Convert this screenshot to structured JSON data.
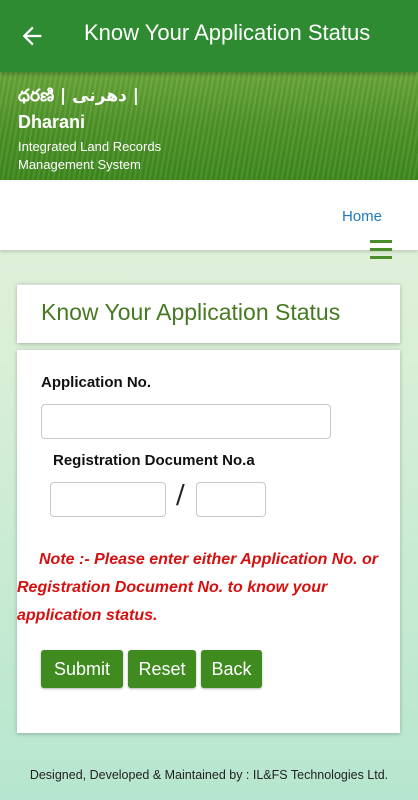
{
  "appbar": {
    "title": "Know Your Application Status",
    "back_icon": "arrow-left-icon",
    "bg_color": "#2e8b32"
  },
  "banner": {
    "scripts": "ధరణి | دھرنی |",
    "title": "Dharani",
    "subtitle": "Integrated Land Records Management System"
  },
  "nav": {
    "home_label": "Home",
    "menu_icon": "hamburger-menu-icon"
  },
  "page": {
    "heading": "Know Your Application Status"
  },
  "form": {
    "application_label": "Application No.",
    "application_value": "",
    "registration_label": "Registration Document No.a",
    "reg_doc_number_value": "",
    "reg_doc_year_value": "",
    "separator": "/",
    "note_line1": "Note :- Please enter either Application No. or",
    "note_line2": "Registration Document No. to know your",
    "note_line3": "application status.",
    "submit_label": "Submit",
    "reset_label": "Reset",
    "back_label": "Back"
  },
  "footer": {
    "text": "Designed, Developed & Maintained by : IL&FS Technologies Ltd."
  },
  "colors": {
    "primary_green": "#2e8b32",
    "button_green": "#3f8b1f",
    "heading_green": "#467a22",
    "note_red": "#d60f0f",
    "link_blue": "#1f7bb6"
  }
}
